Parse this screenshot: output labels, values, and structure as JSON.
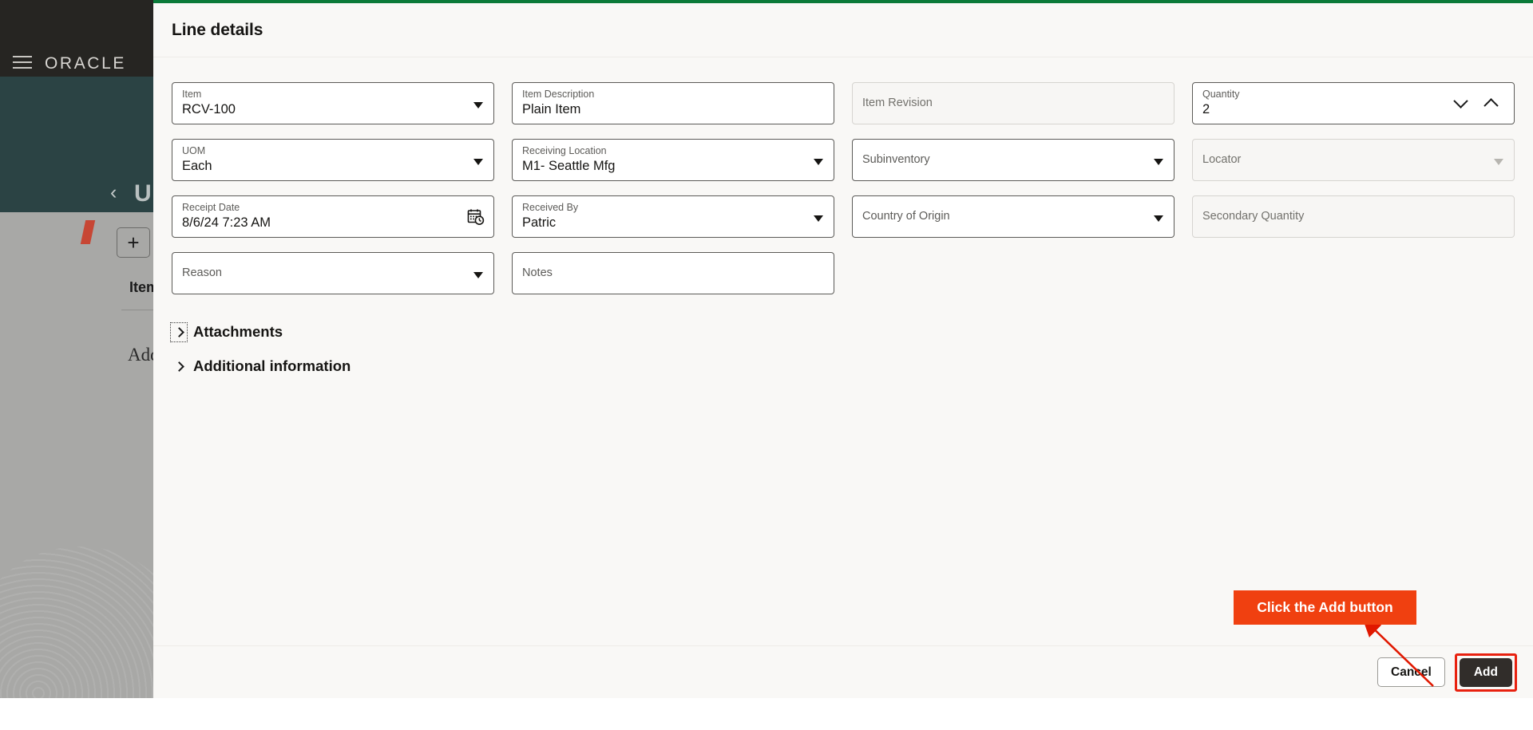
{
  "background": {
    "brand": "ORACLE",
    "menu_icon": "hamburger-menu-icon",
    "back_icon": "back-chevron-icon",
    "page_title": "U",
    "add_icon": "plus-icon",
    "item_label": "Item",
    "add_text": "Add",
    "topbar_color": "#262522",
    "banner_color": "#2b4344",
    "accent_color": "#c74634"
  },
  "panel": {
    "title": "Line details",
    "accent_top_color": "#0b7a39",
    "background_color": "#f9f8f6"
  },
  "form": {
    "fields": [
      {
        "name": "item",
        "label": "Item",
        "value": "RCV-100",
        "control": "dropdown",
        "disabled": false
      },
      {
        "name": "item-description",
        "label": "Item Description",
        "value": "Plain Item",
        "control": "text",
        "disabled": false
      },
      {
        "name": "item-revision",
        "label": "Item Revision",
        "value": "",
        "control": "text",
        "disabled": true
      },
      {
        "name": "quantity",
        "label": "Quantity",
        "value": "2",
        "control": "stepper",
        "disabled": false
      },
      {
        "name": "uom",
        "label": "UOM",
        "value": "Each",
        "control": "dropdown",
        "disabled": false
      },
      {
        "name": "receiving-location",
        "label": "Receiving Location",
        "value": "M1- Seattle Mfg",
        "control": "dropdown",
        "disabled": false
      },
      {
        "name": "subinventory",
        "label": "Subinventory",
        "value": "",
        "control": "dropdown",
        "disabled": false
      },
      {
        "name": "locator",
        "label": "Locator",
        "value": "",
        "control": "dropdown",
        "disabled": true
      },
      {
        "name": "receipt-date",
        "label": "Receipt Date",
        "value": "8/6/24 7:23 AM",
        "control": "date",
        "disabled": false
      },
      {
        "name": "received-by",
        "label": "Received By",
        "value": "Patric",
        "control": "dropdown",
        "disabled": false
      },
      {
        "name": "country-of-origin",
        "label": "Country of Origin",
        "value": "",
        "control": "dropdown",
        "disabled": false
      },
      {
        "name": "secondary-quantity",
        "label": "Secondary Quantity",
        "value": "",
        "control": "text",
        "disabled": true
      },
      {
        "name": "reason",
        "label": "Reason",
        "value": "",
        "control": "dropdown",
        "disabled": false
      },
      {
        "name": "notes",
        "label": "Notes",
        "value": "",
        "control": "text",
        "disabled": false
      }
    ]
  },
  "accordions": [
    {
      "name": "attachments",
      "label": "Attachments",
      "expanded": false,
      "focused": true
    },
    {
      "name": "additional-information",
      "label": "Additional information",
      "expanded": false,
      "focused": false
    }
  ],
  "footer": {
    "cancel_label": "Cancel",
    "add_label": "Add",
    "add_highlight_color": "#e8210f"
  },
  "annotation": {
    "callout_text": "Click the Add button",
    "callout_color": "#f04010",
    "arrow_color": "#e01800"
  }
}
